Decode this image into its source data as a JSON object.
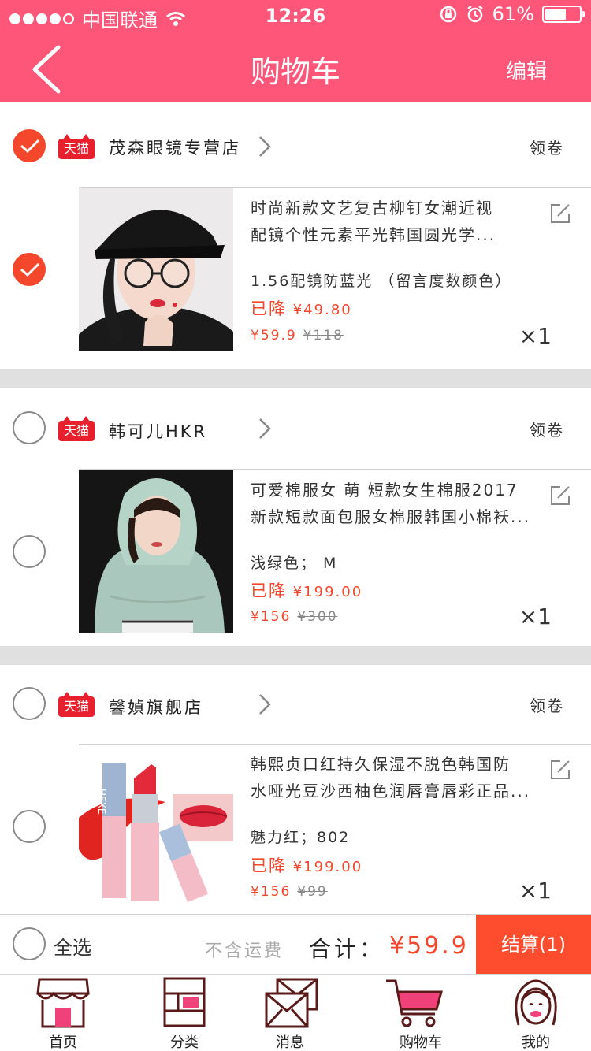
{
  "status_bar": {
    "carrier": "中国联通",
    "time": "12:26",
    "battery": "61%",
    "battery_level": 0.61
  },
  "header": {
    "title": "购物车",
    "edit_label": "编辑"
  },
  "stores": [
    {
      "checked": true,
      "tmall_badge": "天猫",
      "name": "茂森眼镜专营店",
      "coupon_label": "领卷",
      "item": {
        "checked": true,
        "title_line1": "时尚新款文艺复古柳钉女潮近视",
        "title_line2": "配镜个性元素平光韩国圆光学...",
        "spec": "1.56配镜防蓝光 （留言度数颜色）",
        "discount_label": "已降",
        "discount_amount": "¥49.80",
        "price": "¥59.9",
        "original_price": "¥118",
        "qty": "×1",
        "image": "photo of woman wearing black cap and round glasses"
      }
    },
    {
      "checked": false,
      "tmall_badge": "天猫",
      "name": "韩可儿HKR",
      "coupon_label": "领卷",
      "item": {
        "checked": false,
        "title_line1": "可爱棉服女 萌 短款女生棉服2017",
        "title_line2": "新款短款面包服女棉服韩国小棉袄...",
        "spec": "浅绿色； M",
        "discount_label": "已降",
        "discount_amount": "¥199.00",
        "price": "¥156",
        "original_price": "¥300",
        "qty": "×1",
        "image": "photo of woman in mint green hooded puffer jacket"
      }
    },
    {
      "checked": false,
      "tmall_badge": "天猫",
      "name": "馨媜旗舰店",
      "coupon_label": "领卷",
      "item": {
        "checked": false,
        "title_line1": "韩熙贞口红持久保湿不脱色韩国防",
        "title_line2": "水哑光豆沙西柚色润唇膏唇彩正品...",
        "spec": "魅力红；802",
        "discount_label": "已降",
        "discount_amount": "¥199.00",
        "price": "¥156",
        "original_price": "¥99",
        "qty": "×1",
        "image": "product photo of two pink lipsticks with red swatch"
      }
    }
  ],
  "footer": {
    "select_all_label": "全选",
    "shipping_note": "不含运费",
    "total_label": "合计：",
    "total_value": "¥59.9",
    "checkout_label": "结算(1)"
  },
  "tabbar": {
    "tabs": [
      {
        "label": "首页",
        "icon": "home-store-icon"
      },
      {
        "label": "分类",
        "icon": "category-icon"
      },
      {
        "label": "消息",
        "icon": "message-icon"
      },
      {
        "label": "购物车",
        "icon": "cart-icon"
      },
      {
        "label": "我的",
        "icon": "profile-icon"
      }
    ]
  },
  "colors": {
    "brand": "#fd5679",
    "accent": "#f4472b",
    "checkout": "#fd4c2e",
    "tmall": "#e8202e"
  }
}
